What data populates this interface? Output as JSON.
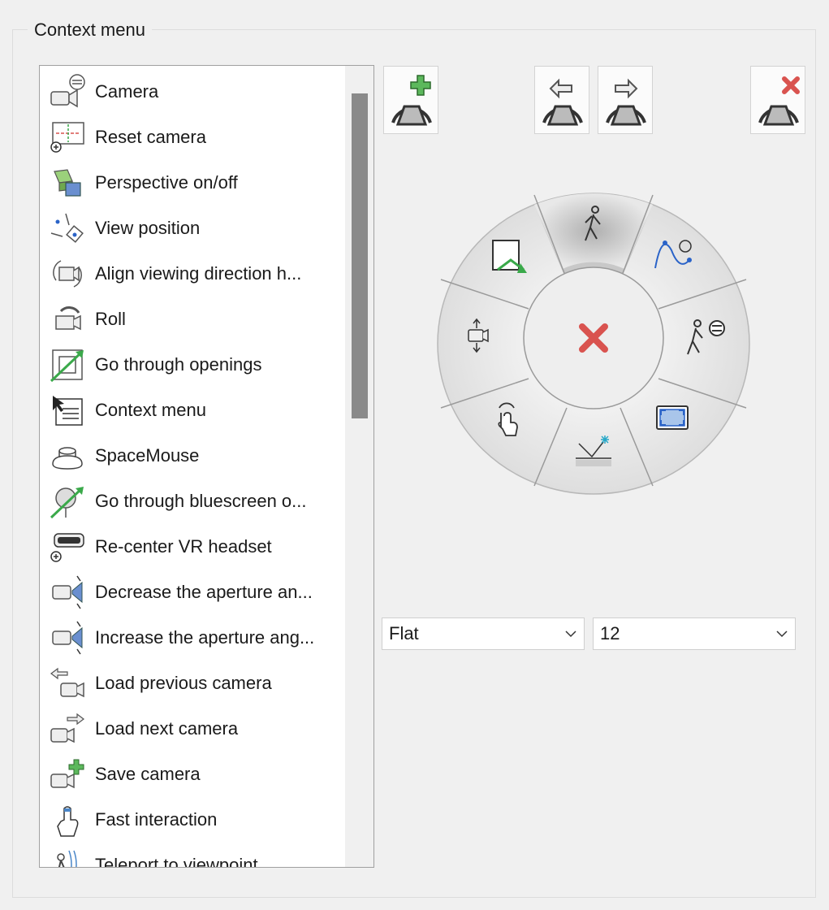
{
  "group_title": "Context menu",
  "list": {
    "items": [
      {
        "label": "Camera",
        "icon": "camera-settings-icon"
      },
      {
        "label": "Reset camera",
        "icon": "reset-camera-icon"
      },
      {
        "label": "Perspective on/off",
        "icon": "perspective-icon"
      },
      {
        "label": "View position",
        "icon": "view-position-icon"
      },
      {
        "label": "Align viewing direction h...",
        "icon": "align-direction-icon"
      },
      {
        "label": "Roll",
        "icon": "roll-icon"
      },
      {
        "label": "Go through openings",
        "icon": "go-through-openings-icon"
      },
      {
        "label": "Context menu",
        "icon": "context-menu-icon"
      },
      {
        "label": "SpaceMouse",
        "icon": "spacemouse-icon"
      },
      {
        "label": "Go through bluescreen o...",
        "icon": "bluescreen-icon"
      },
      {
        "label": "Re-center VR headset",
        "icon": "vr-headset-icon"
      },
      {
        "label": "Decrease the aperture an...",
        "icon": "decrease-aperture-icon"
      },
      {
        "label": "Increase the aperture ang...",
        "icon": "increase-aperture-icon"
      },
      {
        "label": "Load previous camera",
        "icon": "load-previous-camera-icon"
      },
      {
        "label": "Load next camera",
        "icon": "load-next-camera-icon"
      },
      {
        "label": "Save camera",
        "icon": "save-camera-icon"
      },
      {
        "label": "Fast interaction",
        "icon": "fast-interaction-icon"
      },
      {
        "label": "Teleport to viewpoint",
        "icon": "teleport-icon"
      }
    ]
  },
  "toolbar": {
    "add": "add-segment-icon",
    "move_left": "move-segment-left-icon",
    "move_right": "move-segment-right-icon",
    "remove": "remove-segment-icon"
  },
  "radial_menu": {
    "center": "close-x-icon",
    "segments": [
      "walk-icon",
      "path-animation-icon",
      "walk-settings-icon",
      "fullscreen-icon",
      "light-position-icon",
      "touch-icon",
      "move-camera-icon",
      "go-through-openings-icon"
    ]
  },
  "style_combo": {
    "value": "Flat"
  },
  "count_combo": {
    "value": "12"
  },
  "colors": {
    "accent_green": "#3aa94a",
    "accent_red": "#d9534f",
    "accent_blue": "#4a86c8"
  }
}
